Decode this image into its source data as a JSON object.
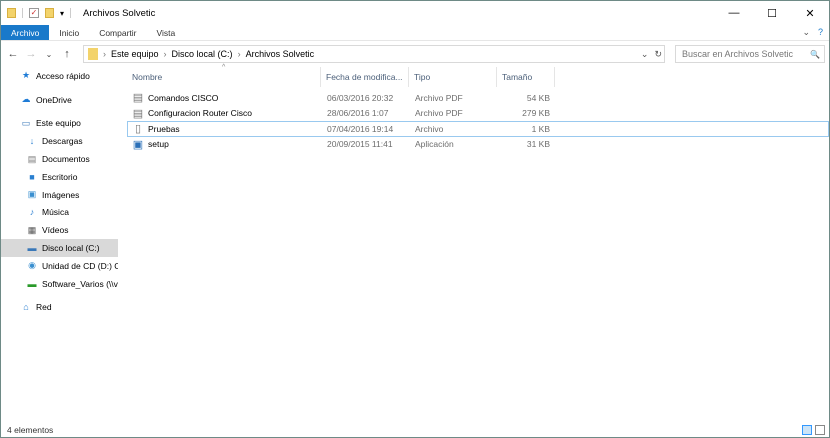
{
  "window": {
    "title": "Archivos Solvetic",
    "minimize": "—",
    "maximize": "☐",
    "close": "✕"
  },
  "ribbon": {
    "tabs": [
      "Archivo",
      "Inicio",
      "Compartir",
      "Vista"
    ],
    "active": "Archivo",
    "expand": "⌄",
    "help": "?"
  },
  "address": {
    "crumbs": [
      "Este equipo",
      "Disco local (C:)",
      "Archivos Solvetic"
    ],
    "dropdown": "⌄",
    "refresh": "↻"
  },
  "search": {
    "placeholder": "Buscar en Archivos Solvetic",
    "icon": "🔍"
  },
  "sidebar": {
    "items": [
      {
        "label": "Acceso rápido",
        "icon": "star-icon",
        "glyph": "★",
        "color": "#1e7bd6"
      },
      {
        "label": "OneDrive",
        "icon": "cloud-icon",
        "glyph": "☁",
        "color": "#1e7bd6"
      },
      {
        "label": "Este equipo",
        "icon": "computer-icon",
        "glyph": "▭",
        "color": "#3a78b8"
      },
      {
        "label": "Descargas",
        "icon": "download-icon",
        "glyph": "↓",
        "color": "#2a7fd0"
      },
      {
        "label": "Documentos",
        "icon": "documents-icon",
        "glyph": "▤",
        "color": "#777"
      },
      {
        "label": "Escritorio",
        "icon": "desktop-icon",
        "glyph": "■",
        "color": "#2a7fd0"
      },
      {
        "label": "Imágenes",
        "icon": "pictures-icon",
        "glyph": "▣",
        "color": "#3a8fd0"
      },
      {
        "label": "Música",
        "icon": "music-icon",
        "glyph": "♪",
        "color": "#2a7fd0"
      },
      {
        "label": "Vídeos",
        "icon": "videos-icon",
        "glyph": "▦",
        "color": "#555"
      },
      {
        "label": "Disco local (C:)",
        "icon": "drive-icon",
        "glyph": "▬",
        "color": "#3a78b8"
      },
      {
        "label": "Unidad de CD (D:) C",
        "icon": "cd-drive-icon",
        "glyph": "◉",
        "color": "#3a8fd0"
      },
      {
        "label": "Software_Varios (\\\\v",
        "icon": "network-drive-icon",
        "glyph": "▬",
        "color": "#2a9a2a"
      },
      {
        "label": "Red",
        "icon": "network-icon",
        "glyph": "⌂",
        "color": "#2a7fd0"
      }
    ]
  },
  "columns": [
    "Nombre",
    "Fecha de modifica...",
    "Tipo",
    "Tamaño"
  ],
  "files": [
    {
      "name": "Comandos CISCO",
      "date": "06/03/2016 20:32",
      "type": "Archivo PDF",
      "size": "54 KB",
      "icon": "pdf-file-icon"
    },
    {
      "name": "Configuracion Router Cisco",
      "date": "28/06/2016 1:07",
      "type": "Archivo PDF",
      "size": "279 KB",
      "icon": "pdf-file-icon"
    },
    {
      "name": "Pruebas",
      "date": "07/04/2016 19:14",
      "type": "Archivo",
      "size": "1 KB",
      "icon": "file-icon"
    },
    {
      "name": "setup",
      "date": "20/09/2015 11:41",
      "type": "Aplicación",
      "size": "31 KB",
      "icon": "application-icon"
    }
  ],
  "status": "4 elementos"
}
